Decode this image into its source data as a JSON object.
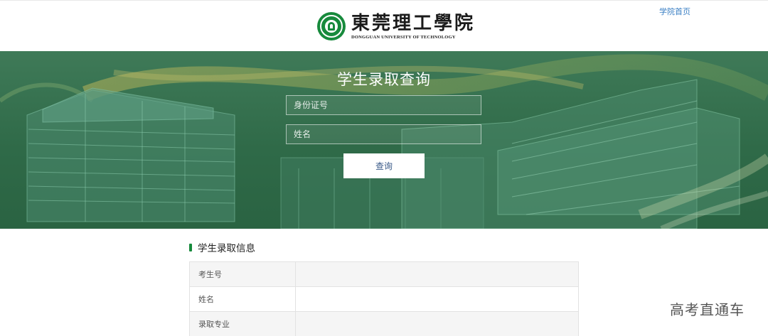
{
  "header": {
    "logo_cn": "東莞理工學院",
    "logo_en": "DONGGUAN UNIVERSITY OF TECHNOLOGY",
    "home_link": "学院首页"
  },
  "query": {
    "title": "学生录取查询",
    "id_placeholder": "身份证号",
    "name_placeholder": "姓名",
    "submit_label": "查询"
  },
  "results": {
    "title": "学生录取信息",
    "rows": [
      {
        "label": "考生号",
        "value": ""
      },
      {
        "label": "姓名",
        "value": ""
      },
      {
        "label": "录取专业",
        "value": ""
      }
    ]
  },
  "watermark": "高考直通车",
  "colors": {
    "brand_green": "#178a3c",
    "banner_green": "#2f6a48",
    "link_blue": "#3a7fc4"
  },
  "icons": {
    "logo": "university-emblem-icon",
    "section_marker": "green-bar-icon"
  }
}
